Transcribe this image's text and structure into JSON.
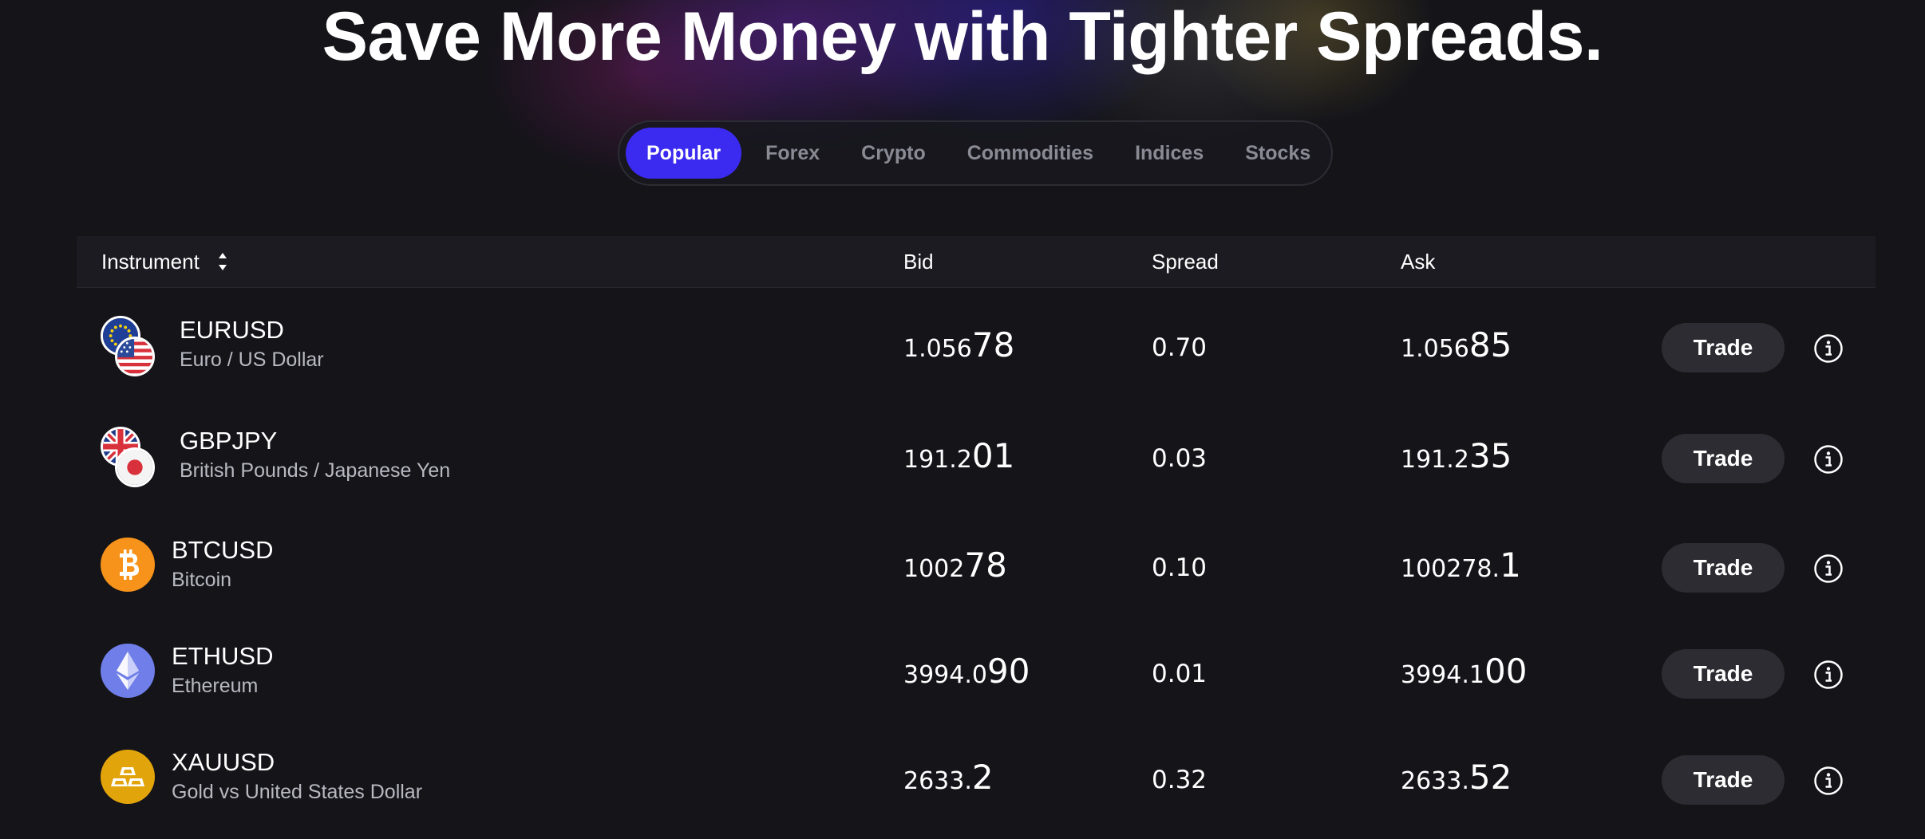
{
  "headline": "Save More Money with Tighter Spreads.",
  "tabs": [
    {
      "label": "Popular",
      "active": true
    },
    {
      "label": "Forex",
      "active": false
    },
    {
      "label": "Crypto",
      "active": false
    },
    {
      "label": "Commodities",
      "active": false
    },
    {
      "label": "Indices",
      "active": false
    },
    {
      "label": "Stocks",
      "active": false
    }
  ],
  "columns": {
    "instrument": "Instrument",
    "bid": "Bid",
    "spread": "Spread",
    "ask": "Ask"
  },
  "trade_label": "Trade",
  "colors": {
    "accent": "#3b2bf0",
    "background": "#141419",
    "button": "#2c2c32"
  },
  "rows": [
    {
      "symbol": "EURUSD",
      "name": "Euro / US Dollar",
      "icon": "eu-us-flags-icon",
      "bid_main": "1.056",
      "bid_pip": "78",
      "spread": "0.70",
      "ask_main": "1.056",
      "ask_pip": "85"
    },
    {
      "symbol": "GBPJPY",
      "name": "British Pounds / Japanese Yen",
      "icon": "uk-japan-flags-icon",
      "bid_main": "191.2",
      "bid_pip": "01",
      "spread": "0.03",
      "ask_main": "191.2",
      "ask_pip": "35"
    },
    {
      "symbol": "BTCUSD",
      "name": "Bitcoin",
      "icon": "bitcoin-icon",
      "bid_main": "1002",
      "bid_pip": "78",
      "spread": "0.10",
      "ask_main": "100278.",
      "ask_pip": "1"
    },
    {
      "symbol": "ETHUSD",
      "name": "Ethereum",
      "icon": "ethereum-icon",
      "bid_main": "3994.0",
      "bid_pip": "90",
      "spread": "0.01",
      "ask_main": "3994.1",
      "ask_pip": "00"
    },
    {
      "symbol": "XAUUSD",
      "name": "Gold vs United States Dollar",
      "icon": "gold-bars-icon",
      "bid_main": "2633.",
      "bid_pip": "2",
      "spread": "0.32",
      "ask_main": "2633.",
      "ask_pip": "52"
    }
  ]
}
